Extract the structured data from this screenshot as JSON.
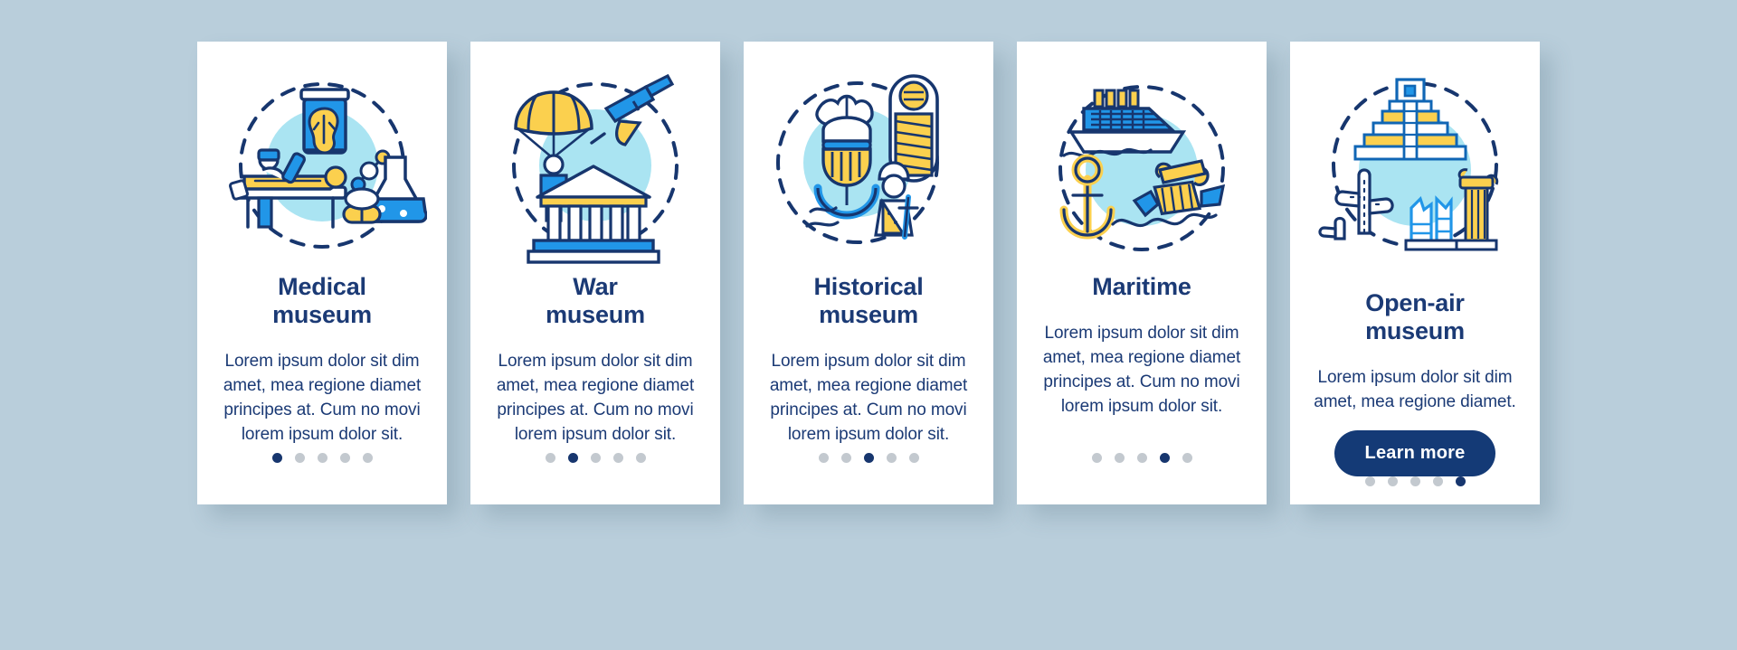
{
  "page": {
    "background_color": "#b9cedb",
    "card_background": "#ffffff",
    "accent_dark_blue": "#1b3a75",
    "accent_blue": "#2196e8",
    "accent_light_blue": "#aae4f2",
    "accent_yellow": "#fbd04e",
    "dot_inactive_color": "#c3c9cf",
    "dot_active_color": "#17366e"
  },
  "cards": [
    {
      "id": "medical-museum",
      "icon": "medical-museum-icon",
      "title": "Medical\nmuseum",
      "body": "Lorem ipsum dolor sit dim amet, mea regione diamet principes at. Cum no movi lorem ipsum dolor sit.",
      "dots": {
        "total": 5,
        "active": 1
      },
      "button": null
    },
    {
      "id": "war-museum",
      "icon": "war-museum-icon",
      "title": "War\nmuseum",
      "body": "Lorem ipsum dolor sit dim amet, mea regione diamet principes at. Cum no movi lorem ipsum dolor sit.",
      "dots": {
        "total": 5,
        "active": 2
      },
      "button": null
    },
    {
      "id": "historical-museum",
      "icon": "historical-museum-icon",
      "title": "Historical\nmuseum",
      "body": "Lorem ipsum dolor sit dim amet, mea regione diamet principes at. Cum no movi lorem ipsum dolor sit.",
      "dots": {
        "total": 5,
        "active": 3
      },
      "button": null
    },
    {
      "id": "maritime",
      "icon": "maritime-icon",
      "title": "Maritime",
      "body": "Lorem ipsum dolor sit dim amet, mea regione diamet principes at. Cum no movi lorem ipsum dolor sit.",
      "dots": {
        "total": 5,
        "active": 4
      },
      "button": null
    },
    {
      "id": "open-air-museum",
      "icon": "open-air-museum-icon",
      "title": "Open-air\nmuseum",
      "body": "Lorem ipsum dolor sit dim amet, mea regione diamet.",
      "dots": {
        "total": 5,
        "active": 5
      },
      "button": "Learn more"
    }
  ]
}
